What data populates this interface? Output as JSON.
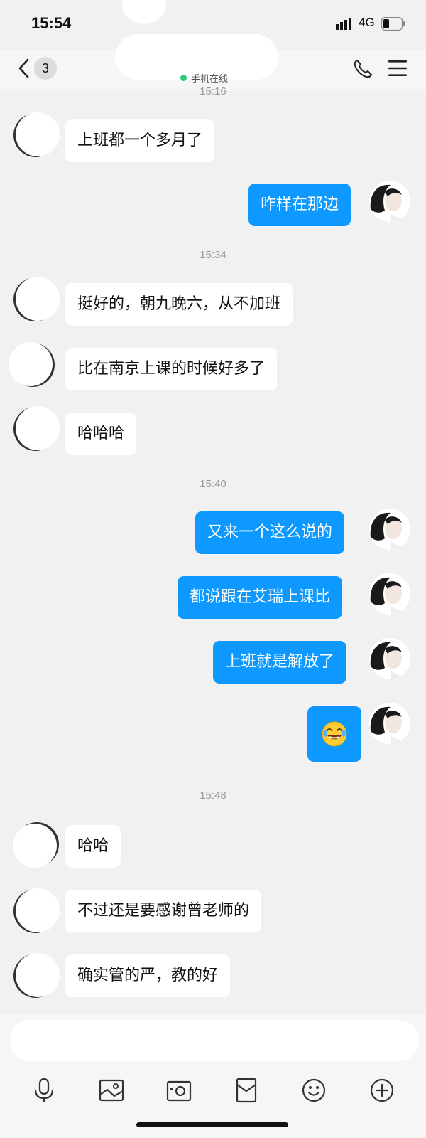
{
  "status": {
    "time": "15:54",
    "network": "4G"
  },
  "nav": {
    "back_count": "3",
    "online_status": "手机在线"
  },
  "timestamps": {
    "t1": "15:16",
    "t2": "15:34",
    "t3": "15:40",
    "t4": "15:48"
  },
  "messages": [
    {
      "from": "friend",
      "text": "上班都一个多月了"
    },
    {
      "from": "me",
      "text": "咋样在那边"
    },
    {
      "from": "friend",
      "text": "挺好的，朝九晚六，从不加班"
    },
    {
      "from": "friend",
      "text": "比在南京上课的时候好多了"
    },
    {
      "from": "friend",
      "text": "哈哈哈"
    },
    {
      "from": "me",
      "text": "又来一个这么说的"
    },
    {
      "from": "me",
      "text": "都说跟在艾瑞上课比"
    },
    {
      "from": "me",
      "text": "上班就是解放了"
    },
    {
      "from": "me",
      "emoji": "tears-of-joy"
    },
    {
      "from": "friend",
      "text": "哈哈"
    },
    {
      "from": "friend",
      "text": "不过还是要感谢曾老师的"
    },
    {
      "from": "friend",
      "text": "确实管的严，教的好"
    }
  ],
  "toolbar": {
    "icons": [
      "microphone-icon",
      "image-icon",
      "camera-icon",
      "red-packet-icon",
      "emoji-icon",
      "plus-icon"
    ]
  },
  "colors": {
    "outgoing_bubble": "#0d99ff",
    "incoming_bubble": "#ffffff",
    "background": "#f1f1f1"
  }
}
